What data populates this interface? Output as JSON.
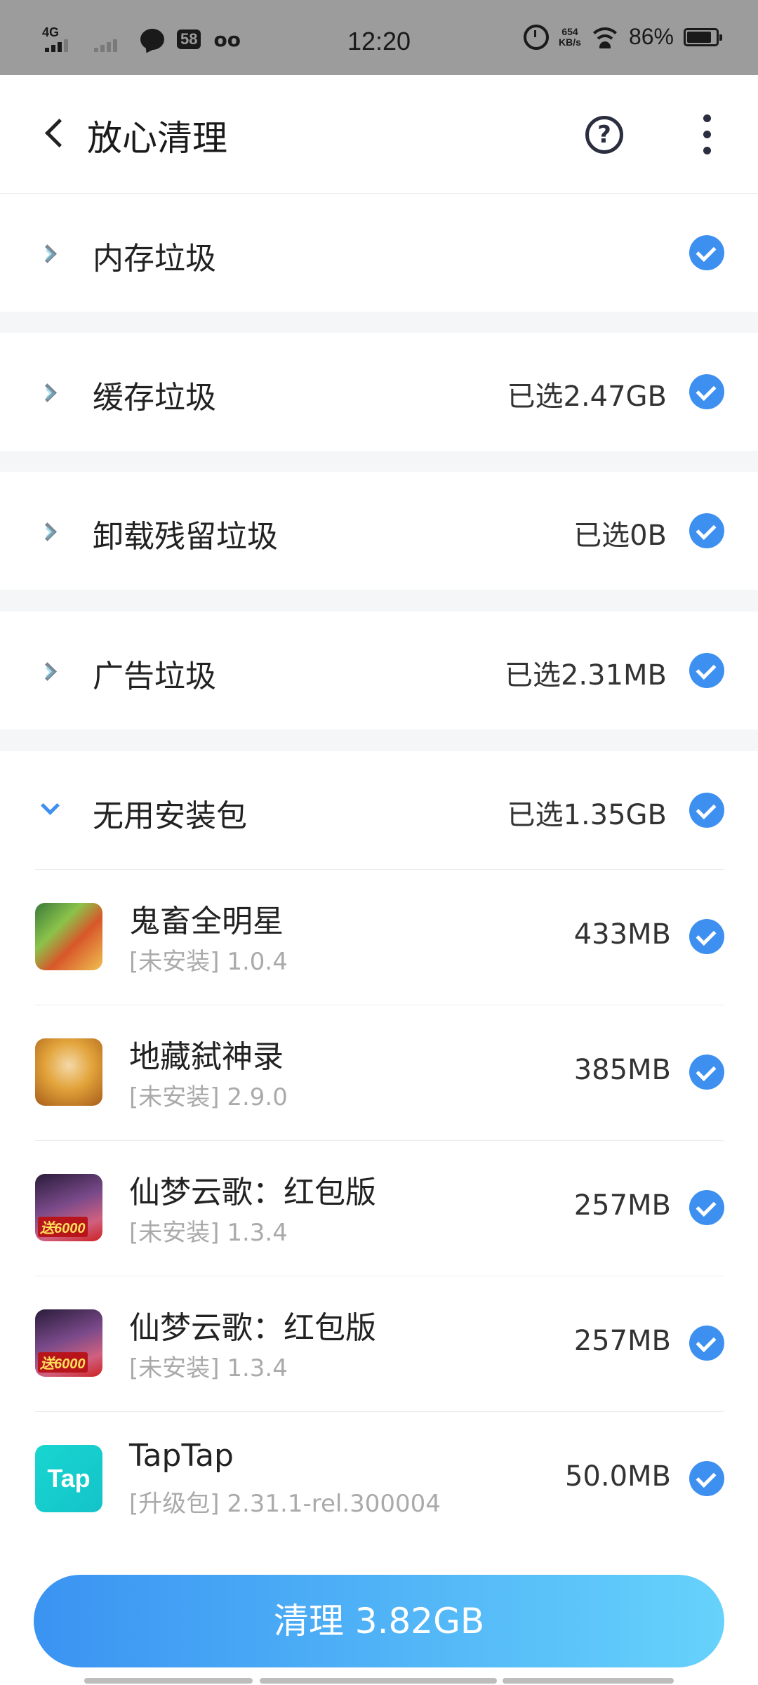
{
  "status_bar": {
    "signal1_label": "4G",
    "time": "12:20",
    "badge": "58",
    "voicemail": "oo",
    "net_speed": "654",
    "net_unit": "KB/s",
    "battery": "86%"
  },
  "header": {
    "title": "放心清理",
    "help_symbol": "?"
  },
  "categories": [
    {
      "label": "内存垃圾",
      "size": ""
    },
    {
      "label": "缓存垃圾",
      "size": "已选2.47GB"
    },
    {
      "label": "卸载残留垃圾",
      "size": "已选0B"
    },
    {
      "label": "广告垃圾",
      "size": "已选2.31MB"
    },
    {
      "label": "无用安装包",
      "size": "已选1.35GB"
    }
  ],
  "apps": [
    {
      "name": "鬼畜全明星",
      "sub": "[未安装] 1.0.4",
      "size": "433MB",
      "icon": "guichu-app-icon"
    },
    {
      "name": "地藏弑神录",
      "sub": "[未安装] 2.9.0",
      "size": "385MB",
      "icon": "dizang-app-icon"
    },
    {
      "name": "仙梦云歌：红包版",
      "sub": "[未安装] 1.3.4",
      "size": "257MB",
      "icon": "xianmeng-app-icon",
      "icon_text": "送6000"
    },
    {
      "name": "仙梦云歌：红包版",
      "sub": "[未安装] 1.3.4",
      "size": "257MB",
      "icon": "xianmeng-app-icon",
      "icon_text": "送6000"
    },
    {
      "name": "TapTap",
      "sub": "[升级包] 2.31.1-rel.300004",
      "size": "50.0MB",
      "icon": "taptap-app-icon",
      "icon_text": "Tap"
    }
  ],
  "clean_button": "清理 3.82GB",
  "colors": {
    "accent": "#3d8ff0",
    "button_start": "#3a93f2",
    "button_end": "#66d2fb"
  }
}
